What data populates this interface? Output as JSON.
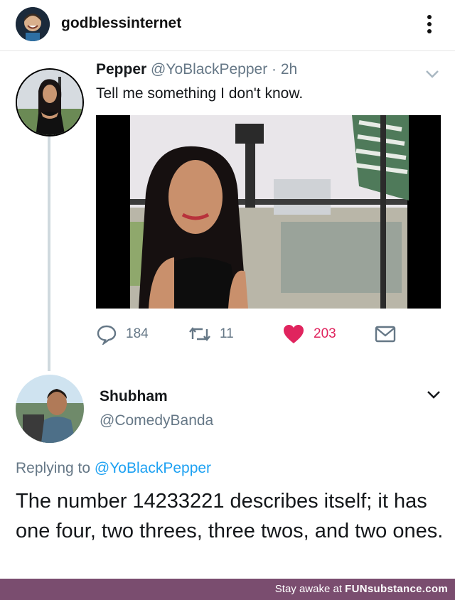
{
  "header": {
    "username": "godblessinternet"
  },
  "tweet": {
    "author_name": "Pepper",
    "author_handle": "@YoBlackPepper",
    "time": "· 2h",
    "text": "Tell me something I don't know.",
    "stats": {
      "replies": "184",
      "retweets": "11",
      "likes": "203"
    }
  },
  "reply": {
    "author_name": "Shubham",
    "author_handle": "@ComedyBanda",
    "replying_prefix": "Replying to",
    "replying_handle": "@YoBlackPepper",
    "text": "The number 14233221 describes itself; it has one four, two threes, three twos, and two ones."
  },
  "footer": {
    "prefix": "Stay awake at",
    "brand": "FUNsubstance.com"
  },
  "colors": {
    "like": "#e0245e",
    "link": "#1da1f2",
    "footer_bg": "#7a4d6f"
  }
}
